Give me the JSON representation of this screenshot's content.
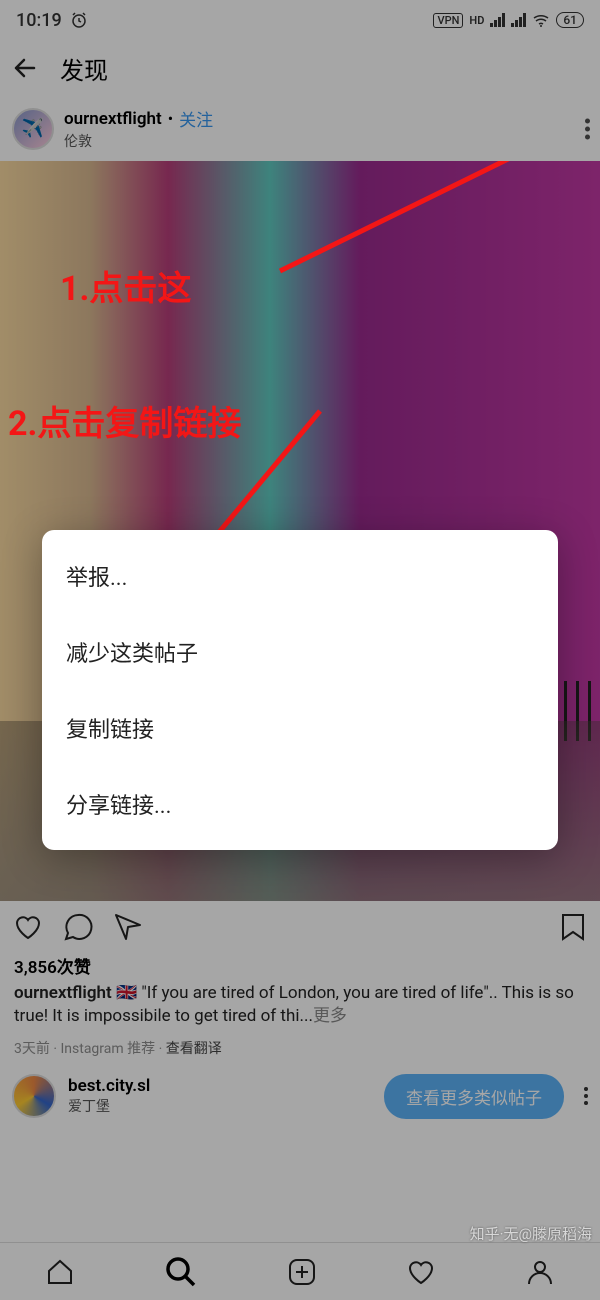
{
  "status": {
    "time": "10:19",
    "alarm_icon": "alarm-icon",
    "vpn": "VPN",
    "hd": "HD",
    "battery": "61"
  },
  "header": {
    "title": "发现"
  },
  "post": {
    "username": "ournextflight",
    "follow_label": "关注",
    "location": "伦敦",
    "likes": "3,856次赞",
    "caption_user": "ournextflight",
    "caption_text": "🇬🇧 \"If you are tired of London, you are tired of life\".. This is so true! It is impossibile to get tired of thi...",
    "more_label": "更多",
    "meta": "3天前 · Instagram 推荐 · ",
    "translate": "查看翻译"
  },
  "annotations": {
    "step1": "1.点击这",
    "step2": "2.点击复制链接"
  },
  "menu": {
    "report": "举报...",
    "reduce": "减少这类帖子",
    "copy_link": "复制链接",
    "share_link": "分享链接..."
  },
  "recommendation": {
    "name": "best.city.sl",
    "location": "爱丁堡",
    "button": "查看更多类似帖子"
  },
  "watermark": "知乎·无@滕原稻海"
}
